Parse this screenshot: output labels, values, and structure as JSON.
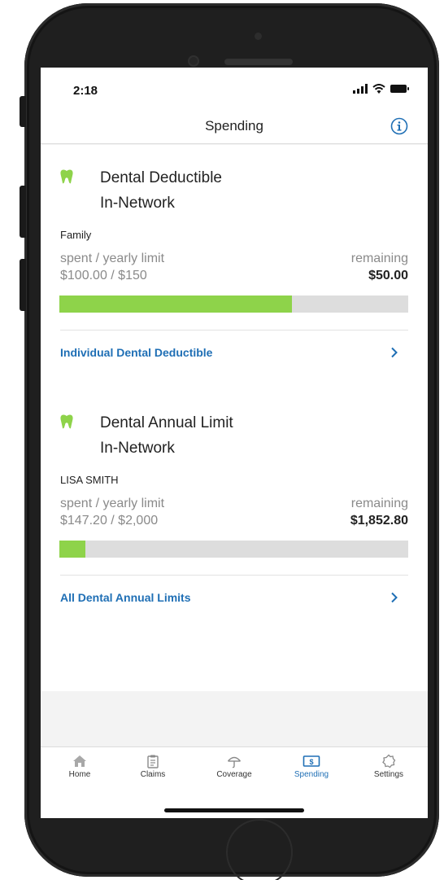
{
  "status_bar": {
    "time": "2:18"
  },
  "nav": {
    "title": "Spending"
  },
  "colors": {
    "accent": "#1f6fb5",
    "progress": "#8ed34a",
    "tooth": "#8ed34a",
    "track": "#dddddd"
  },
  "cards": [
    {
      "title": "Dental Deductible",
      "subtitle": "In-Network",
      "member": "Family",
      "spent_label": "spent / yearly limit",
      "spent_value": "$100.00 / $150",
      "remaining_label": "remaining",
      "remaining_value": "$50.00",
      "progress_fraction": 0.667,
      "link": "Individual Dental Deductible"
    },
    {
      "title": "Dental Annual Limit",
      "subtitle": "In-Network",
      "member": "LISA SMITH",
      "spent_label": "spent / yearly limit",
      "spent_value": "$147.20 / $2,000",
      "remaining_label": "remaining",
      "remaining_value": "$1,852.80",
      "progress_fraction": 0.0736,
      "link": "All Dental Annual Limits"
    }
  ],
  "tabs": [
    {
      "label": "Home",
      "icon": "home-icon",
      "active": false
    },
    {
      "label": "Claims",
      "icon": "clipboard-icon",
      "active": false
    },
    {
      "label": "Coverage",
      "icon": "umbrella-icon",
      "active": false
    },
    {
      "label": "Spending",
      "icon": "dollar-card-icon",
      "active": true
    },
    {
      "label": "Settings",
      "icon": "gear-icon",
      "active": false
    }
  ]
}
